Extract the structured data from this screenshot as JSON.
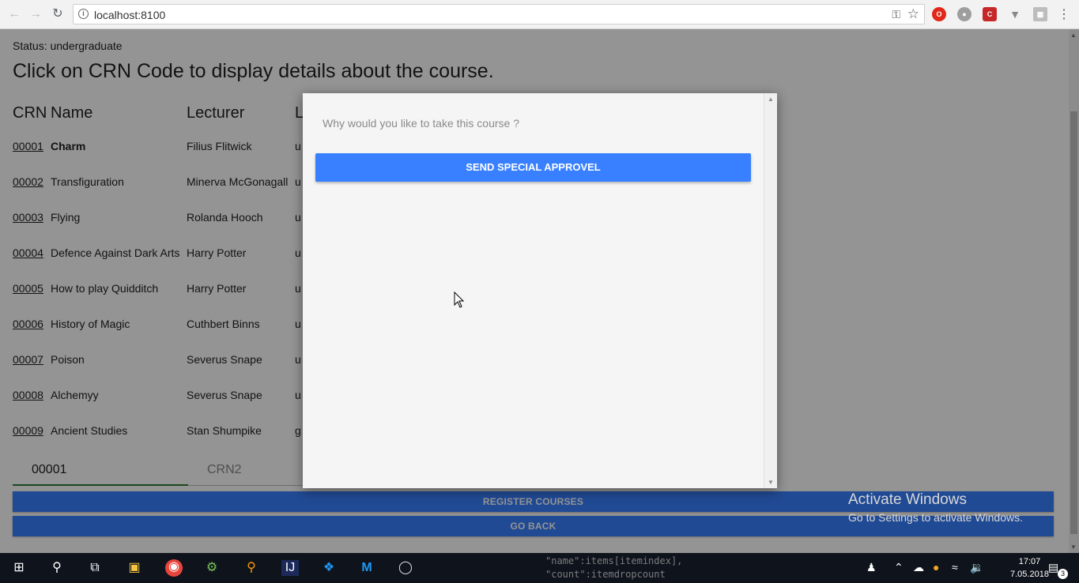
{
  "browser": {
    "url": "localhost:8100",
    "back_icon": "arrow-left-icon",
    "forward_icon": "arrow-right-icon",
    "reload_icon": "reload-icon"
  },
  "page": {
    "status": "Status: undergraduate",
    "heading": "Click on CRN Code to display details about the course.",
    "columns": {
      "crn": "CRN",
      "name": "Name",
      "lecturer": "Lecturer",
      "level": "L"
    },
    "courses": [
      {
        "crn": "00001",
        "name": "Charm",
        "lecturer": "Filius Flitwick",
        "level": "u"
      },
      {
        "crn": "00002",
        "name": "Transfiguration",
        "lecturer": "Minerva McGonagall",
        "level": "u"
      },
      {
        "crn": "00003",
        "name": "Flying",
        "lecturer": "Rolanda Hooch",
        "level": "u"
      },
      {
        "crn": "00004",
        "name": "Defence Against Dark Arts",
        "lecturer": "Harry Potter",
        "level": "u"
      },
      {
        "crn": "00005",
        "name": "How to play Quidditch",
        "lecturer": "Harry Potter",
        "level": "u"
      },
      {
        "crn": "00006",
        "name": "History of Magic",
        "lecturer": "Cuthbert Binns",
        "level": "u"
      },
      {
        "crn": "00007",
        "name": "Poison",
        "lecturer": "Severus Snape",
        "level": "u"
      },
      {
        "crn": "00008",
        "name": "Alchemyy",
        "lecturer": "Severus Snape",
        "level": "u"
      },
      {
        "crn": "00009",
        "name": "Ancient Studies",
        "lecturer": "Stan Shumpike",
        "level": "g"
      }
    ],
    "crn1_value": "00001",
    "crn2_placeholder": "CRN2",
    "register_label": "REGISTER COURSES",
    "go_back_label": "GO BACK"
  },
  "modal": {
    "prompt": "Why would you like to take this course ?",
    "send_label": "SEND SPECIAL APPROVEL"
  },
  "watermark": {
    "line1": "Activate Windows",
    "line2": "Go to Settings to activate Windows."
  },
  "taskbar": {
    "code_line1": "\"name\":items[itemindex],",
    "code_line2": "\"count\":itemdropcount",
    "time": "17:07",
    "date": "7.05.2018",
    "notification_count": "3"
  },
  "colors": {
    "primary": "#3880ff",
    "active_underline": "#2e7d32",
    "taskbar": "#0f141c"
  }
}
